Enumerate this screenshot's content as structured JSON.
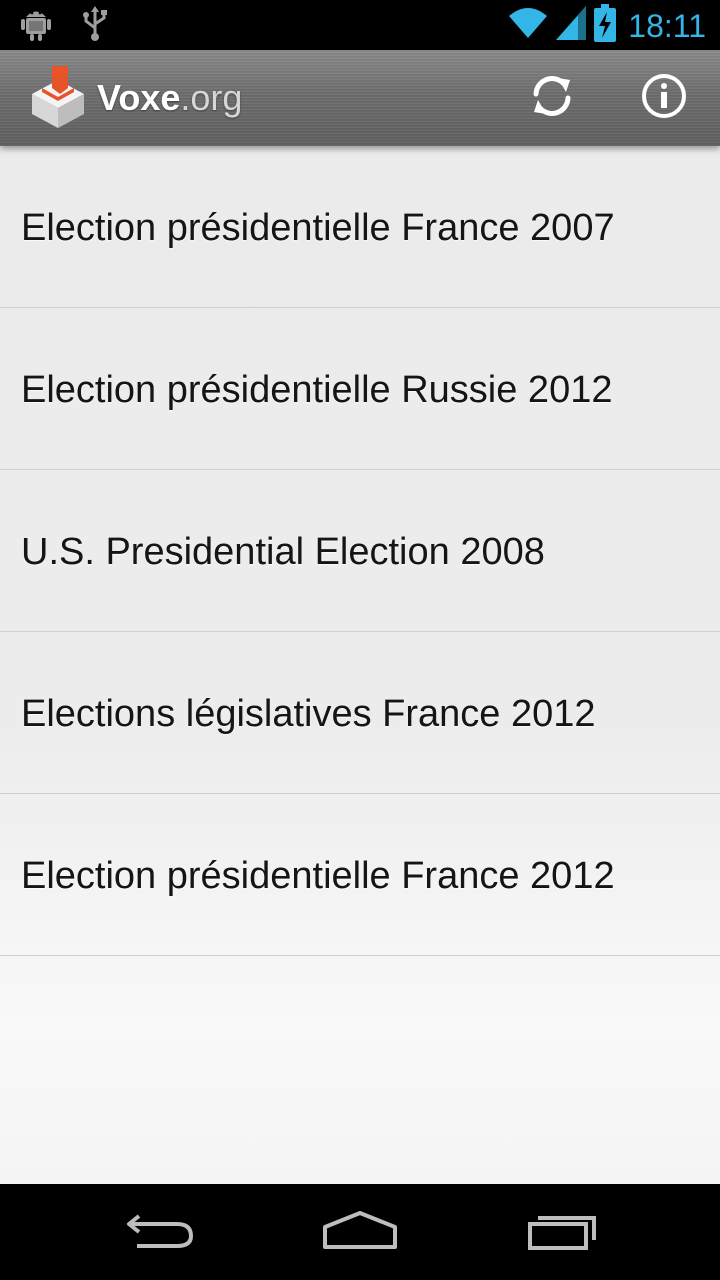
{
  "status_bar": {
    "time": "18:11",
    "icons": [
      "android-debug-icon",
      "usb-icon",
      "wifi-icon",
      "signal-icon",
      "battery-charging-icon"
    ],
    "accent_color": "#33b5e5"
  },
  "action_bar": {
    "brand_main": "Voxe",
    "brand_sub": ".org",
    "logo_icon": "voxe-logo-icon",
    "actions": [
      "refresh-icon",
      "info-icon"
    ],
    "logo_color": "#e8542a"
  },
  "elections": [
    "Election présidentielle France 2007",
    "Election présidentielle Russie 2012",
    "U.S. Presidential Election 2008",
    "Elections législatives France 2012",
    "Election présidentielle France 2012"
  ],
  "nav_bar": {
    "buttons": [
      "back-icon",
      "home-icon",
      "recent-apps-icon"
    ]
  }
}
